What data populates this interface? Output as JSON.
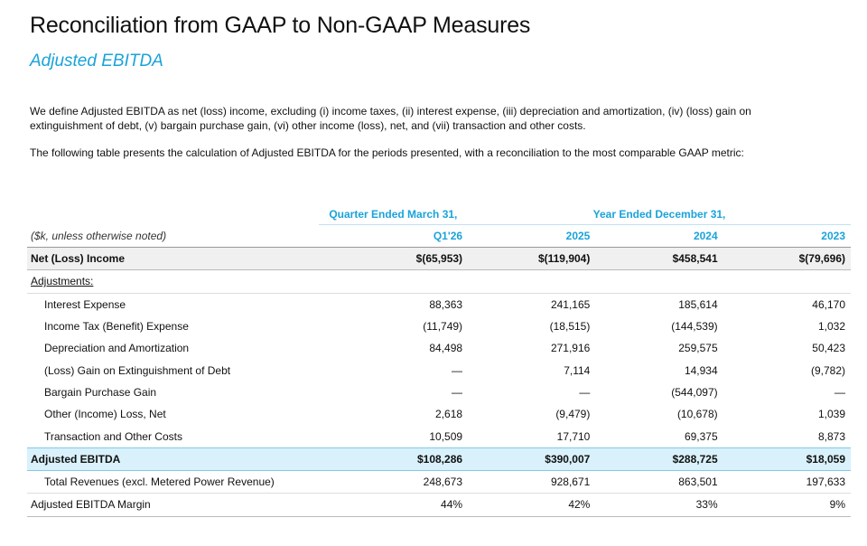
{
  "header": {
    "title": "Reconciliation from GAAP to Non-GAAP Measures",
    "subtitle": "Adjusted EBITDA"
  },
  "intro": {
    "definition": "We define Adjusted EBITDA as net (loss) income, excluding (i) income taxes, (ii) interest expense, (iii) depreciation and amortization, (iv) (loss) gain on extinguishment of debt, (v) bargain purchase gain, (vi) other income (loss), net, and (vii) transaction and other costs.",
    "table_intro": "The following table presents the calculation of Adjusted EBITDA for the periods presented, with a reconciliation to the most comparable GAAP metric:"
  },
  "table": {
    "groups": {
      "quarter": "Quarter Ended March 31,",
      "year": "Year Ended December 31,"
    },
    "unit_note": "($k, unless otherwise noted)",
    "columns": [
      "Q1'26",
      "2025",
      "2024",
      "2023"
    ],
    "net_income": {
      "label": "Net (Loss) Income",
      "values": [
        "$(65,953)",
        "$(119,904)",
        "$458,541",
        "$(79,696)"
      ]
    },
    "adjustments_label": "Adjustments:",
    "adjustments": [
      {
        "label": "Interest Expense",
        "values": [
          "88,363",
          "241,165",
          "185,614",
          "46,170"
        ]
      },
      {
        "label": "Income Tax (Benefit) Expense",
        "values": [
          "(11,749)",
          "(18,515)",
          "(144,539)",
          "1,032"
        ]
      },
      {
        "label": "Depreciation and Amortization",
        "values": [
          "84,498",
          "271,916",
          "259,575",
          "50,423"
        ]
      },
      {
        "label": "(Loss) Gain on Extinguishment of Debt",
        "values": [
          "—",
          "7,114",
          "14,934",
          "(9,782)"
        ]
      },
      {
        "label": "Bargain Purchase Gain",
        "values": [
          "—",
          "—",
          "(544,097)",
          "—"
        ]
      },
      {
        "label": "Other (Income) Loss, Net",
        "values": [
          "2,618",
          "(9,479)",
          "(10,678)",
          "1,039"
        ]
      },
      {
        "label": "Transaction and Other Costs",
        "values": [
          "10,509",
          "17,710",
          "69,375",
          "8,873"
        ]
      }
    ],
    "adjusted_ebitda": {
      "label": "Adjusted EBITDA",
      "values": [
        "$108,286",
        "$390,007",
        "$288,725",
        "$18,059"
      ]
    },
    "total_revenues": {
      "label": "Total Revenues (excl. Metered Power Revenue)",
      "values": [
        "248,673",
        "928,671",
        "863,501",
        "197,633"
      ]
    },
    "margin": {
      "label": "Adjusted EBITDA Margin",
      "values": [
        "44%",
        "42%",
        "33%",
        "9%"
      ]
    }
  }
}
